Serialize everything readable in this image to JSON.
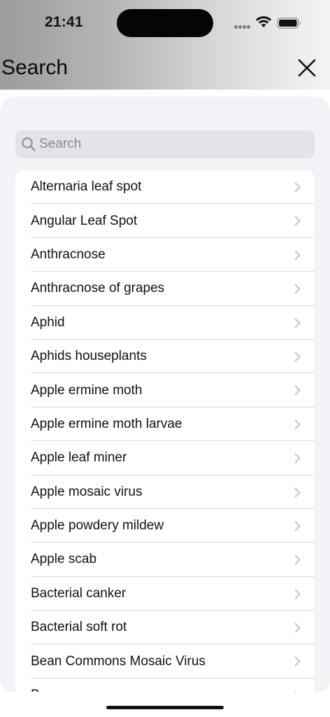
{
  "status_bar": {
    "time": "21:41"
  },
  "header": {
    "title": "Search"
  },
  "search": {
    "placeholder": "Search",
    "value": ""
  },
  "items": [
    "Alternaria leaf spot",
    "Angular Leaf Spot",
    "Anthracnose",
    "Anthracnose of grapes",
    "Aphid",
    "Aphids houseplants",
    "Apple ermine moth",
    "Apple ermine moth larvae",
    "Apple leaf miner",
    "Apple mosaic virus",
    "Apple powdery mildew",
    "Apple scab",
    "Bacterial canker",
    "Bacterial soft rot",
    "Bean Commons Mosaic Virus",
    "B..."
  ],
  "icons": {
    "close": "close-icon",
    "search": "search-icon",
    "chevron": "chevron-right-icon",
    "wifi": "wifi-icon",
    "battery": "battery-icon",
    "signal": "cellular-signal-icon"
  },
  "colors": {
    "sheet_bg": "#f2f2f7",
    "search_bg": "#e3e3e8",
    "chevron": "#c4c4c7",
    "text": "#111111",
    "placeholder": "#8a8a8e"
  }
}
